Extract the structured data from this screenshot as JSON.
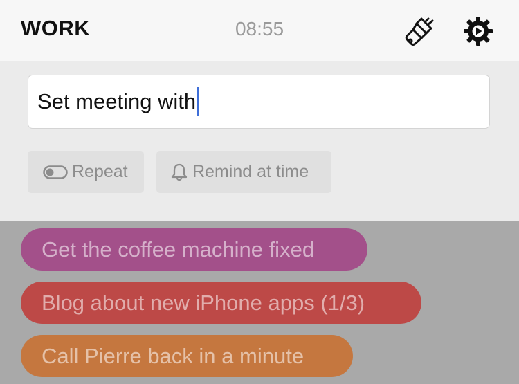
{
  "header": {
    "list_name": "WORK",
    "time": "08:55",
    "theme_icon": "paintbrush-icon",
    "settings_icon": "gear-icon"
  },
  "composer": {
    "input_value": "Set meeting with",
    "repeat_label": "Repeat",
    "repeat_icon": "toggle-icon",
    "remind_label": "Remind at time",
    "remind_icon": "bell-icon"
  },
  "tasks": [
    {
      "label": "Get the coffee machine fixed",
      "color": "#a3508a"
    },
    {
      "label": "Blog about new iPhone apps (1/3)",
      "color": "#bd4947"
    },
    {
      "label": "Call Pierre back in a minute",
      "color": "#c5773f"
    }
  ]
}
